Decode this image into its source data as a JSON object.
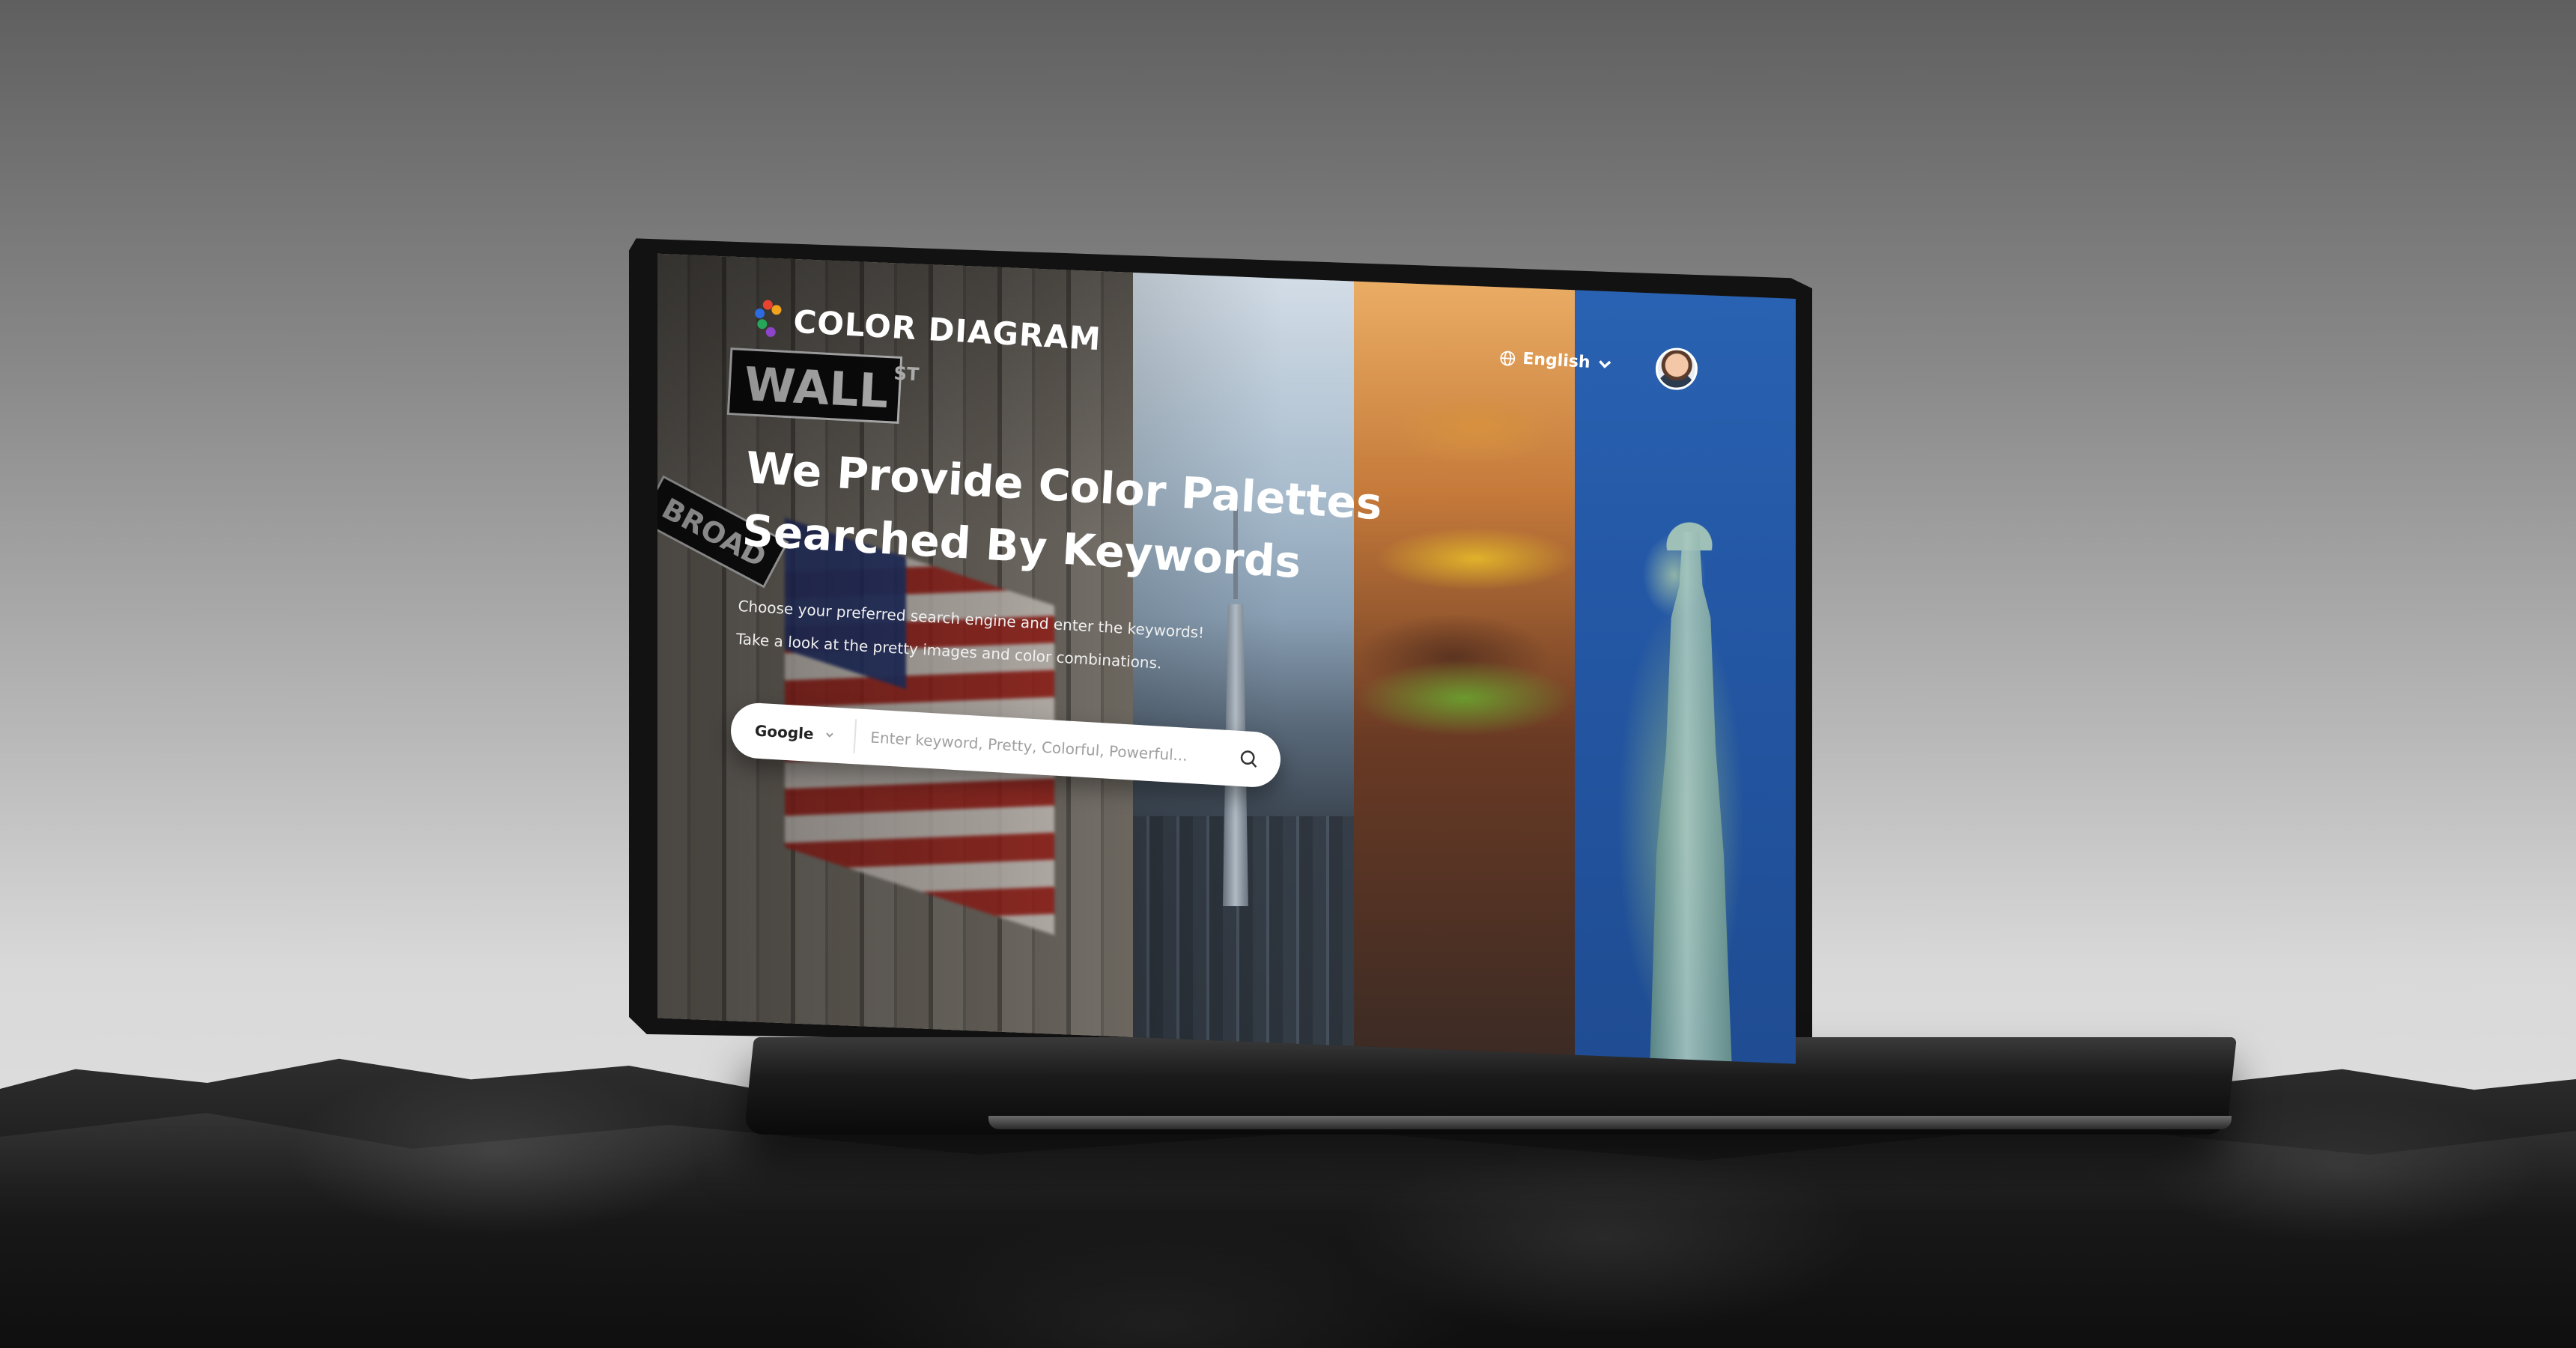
{
  "brand": {
    "name": "COLOR DIAGRAM",
    "logo_colors": [
      "#e8432e",
      "#f2a31c",
      "#2c6be0",
      "#27a65a",
      "#8e44c8"
    ]
  },
  "header": {
    "language": "English",
    "language_icon": "globe-icon",
    "avatar_icon": "user-avatar"
  },
  "hero": {
    "title_line1": "We Provide Color Palettes",
    "title_line2": "Searched By Keywords",
    "subtitle_line1": "Choose your preferred search engine and enter the keywords!",
    "subtitle_line2": "Take a look at the pretty images and color combinations."
  },
  "search": {
    "engine": "Google",
    "placeholder": "Enter keyword, Pretty, Colorful, Powerful...",
    "value": "",
    "icon": "search-icon"
  },
  "background_panels": [
    {
      "subject": "wall-street",
      "sign_text": "WALL",
      "sign_suffix": "ST",
      "secondary_sign": "BROAD"
    },
    {
      "subject": "city-skyline"
    },
    {
      "subject": "burger"
    },
    {
      "subject": "statue-of-liberty"
    }
  ],
  "scroll_hint_icon": "chevron-down-icon",
  "colors": {
    "accent_blue": "#2458a6",
    "text_white": "#ffffff",
    "search_bg": "#ffffff"
  }
}
